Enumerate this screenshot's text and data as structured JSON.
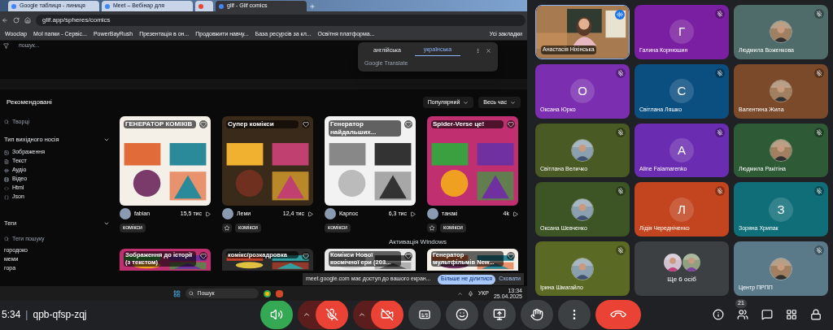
{
  "browser": {
    "tabs": [
      {
        "title": "Google таблиця - линиця",
        "selected": false
      },
      {
        "title": "Meet – Вебінар для",
        "selected": false
      },
      {
        "selected": false
      },
      {
        "title": "glif - Glif comics",
        "selected": true
      }
    ],
    "address": "glif.app/spheres/comics",
    "bookmarks": [
      "Wooclap",
      "Мої папки - Сервіс...",
      "PowerBayRush",
      "Презентація в он...",
      "Продовжити навчу...",
      "База ресурсів за кл...",
      "Освітня платформа..."
    ],
    "bookmarks_all": "Усі закладки",
    "translate": {
      "tabs": [
        {
          "label": "англійська",
          "selected": false
        },
        {
          "label": "українська",
          "selected": true
        }
      ],
      "footer": "Google Translate"
    }
  },
  "page": {
    "search_placeholder": "пошук...",
    "section_title": "Рекомендовані",
    "sort": "Популярний",
    "period": "Весь час",
    "sidebar": {
      "creators_placeholder": "Творці",
      "media_heading": "Тип вихідного носія",
      "media": [
        "Зображення",
        "Текст",
        "Аудіо",
        "Відео",
        "Html",
        "Json"
      ],
      "tags_heading": "Теги",
      "tags_placeholder": "Теги пошуку",
      "tags": [
        "городоко",
        "меми",
        "гора"
      ]
    },
    "cards": [
      {
        "title": "ГЕНЕРАТОР КОМІКІВ",
        "author": "fabian",
        "views": "15,5 тис",
        "tag": "комікси",
        "favorite_button": false
      },
      {
        "title": "Супер комікси",
        "author": "Леми",
        "views": "12,4 тис",
        "tag": "комікси",
        "favorite_button": true
      },
      {
        "title": "Генератор найдальших...",
        "author": "Карлос",
        "views": "6,3 тис",
        "tag": "комікси",
        "favorite_button": false
      },
      {
        "title": "Spider-Verse це!",
        "author": "танакі",
        "views": "4k",
        "tag": "комікси",
        "favorite_button": true
      }
    ],
    "more_cards": [
      "Зображення до історії (з текстом)",
      "комікс/розкадровка",
      "Комікси Нової космічної ери (203...",
      "Генератор мультфільмів New..."
    ],
    "watermark_os": "Активація Windows",
    "share_notice": {
      "text": "meet.google.com має доступ до вашого екран...",
      "stop": "Більше не ділитися",
      "hide": "Сховати"
    }
  },
  "taskbar": {
    "search": "Пошук",
    "language": "УКР",
    "time": "13:34",
    "date": "25.04.2025"
  },
  "tiles": [
    {
      "kind": "video",
      "name": "Анастасія Ніхінська",
      "speaking": true,
      "muted": false
    },
    {
      "kind": "letter",
      "name": "Галина Корнюшин",
      "letter": "Г",
      "muted": true,
      "color": "#7b1fa2"
    },
    {
      "name": "Людмила Воженкова",
      "muted": true,
      "color": "#4f6b6a"
    },
    {
      "kind": "letter",
      "name": "Оксана Юрко",
      "letter": "О",
      "muted": true,
      "color": "#7b2fb0"
    },
    {
      "kind": "letter",
      "name": "Світлана Ляшко",
      "letter": "С",
      "muted": true,
      "color": "#0b4f80"
    },
    {
      "name": "Валентина Жила",
      "muted": true,
      "color": "#7a4a2a"
    },
    {
      "name": "Світлана Величко",
      "muted": true,
      "color": "#4a5a24"
    },
    {
      "kind": "letter",
      "name": "Aline Falamarenko",
      "letter": "А",
      "muted": true,
      "color": "#6a2cb0"
    },
    {
      "name": "Людмила Ракітіна",
      "muted": true,
      "color": "#2f5a36"
    },
    {
      "name": "Оксана Шевченко",
      "muted": true,
      "color": "#3d5524"
    },
    {
      "kind": "letter",
      "name": "Лідія Чередніченко",
      "letter": "Л",
      "muted": true,
      "color": "#c2451f"
    },
    {
      "kind": "letter",
      "name": "Зоряна Хрипак",
      "letter": "З",
      "muted": true,
      "color": "#0f6e78"
    },
    {
      "name": "Ірина Шмагайло",
      "muted": true,
      "color": "#5a6a24"
    },
    {
      "kind": "group",
      "name": "Ще 6 осіб",
      "muted": false,
      "color": "#3c4043"
    },
    {
      "name": "Центр ПРПП",
      "muted": true,
      "color": "#5a7a8a"
    }
  ],
  "meeting": {
    "time": "5:34",
    "separator": "|",
    "code": "qpb-qfsp-zqj",
    "participants": "21"
  },
  "controls": [
    {
      "kind": "speaker"
    },
    {
      "kind": "mic",
      "off": true
    },
    {
      "kind": "camera",
      "off": true
    },
    {
      "kind": "captions",
      "off": false
    },
    {
      "kind": "emoji",
      "off": false
    },
    {
      "kind": "present",
      "off": false
    },
    {
      "kind": "hand",
      "off": false
    },
    {
      "kind": "more",
      "off": false
    },
    {
      "kind": "end"
    }
  ]
}
